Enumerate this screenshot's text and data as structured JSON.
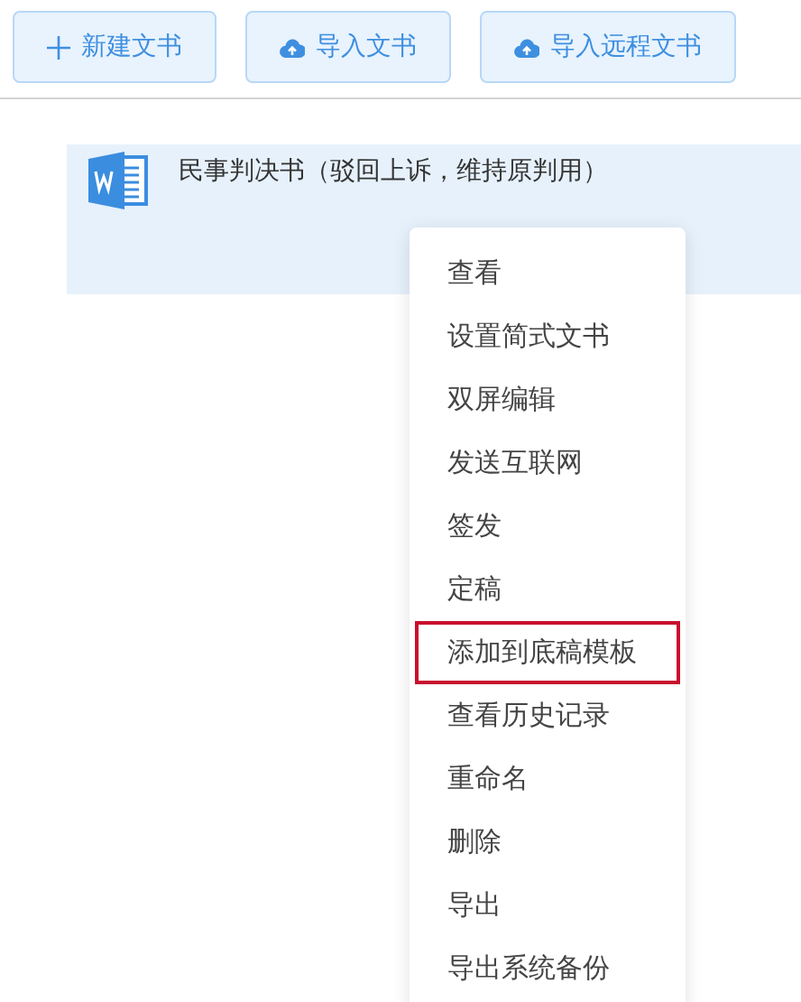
{
  "toolbar": [
    {
      "kind": "new",
      "label": "新建文书"
    },
    {
      "kind": "upload",
      "label": "导入文书"
    },
    {
      "kind": "upload",
      "label": "导入远程文书"
    }
  ],
  "document": {
    "title": "民事判决书（驳回上诉，维持原判用）"
  },
  "context_menu": [
    {
      "label": "查看",
      "highlighted": false
    },
    {
      "label": "设置简式文书",
      "highlighted": false
    },
    {
      "label": "双屏编辑",
      "highlighted": false
    },
    {
      "label": "发送互联网",
      "highlighted": false
    },
    {
      "label": "签发",
      "highlighted": false
    },
    {
      "label": "定稿",
      "highlighted": false
    },
    {
      "label": "添加到底稿模板",
      "highlighted": true
    },
    {
      "label": "查看历史记录",
      "highlighted": false
    },
    {
      "label": "重命名",
      "highlighted": false
    },
    {
      "label": "删除",
      "highlighted": false
    },
    {
      "label": "导出",
      "highlighted": false
    },
    {
      "label": "导出系统备份",
      "highlighted": false
    }
  ]
}
